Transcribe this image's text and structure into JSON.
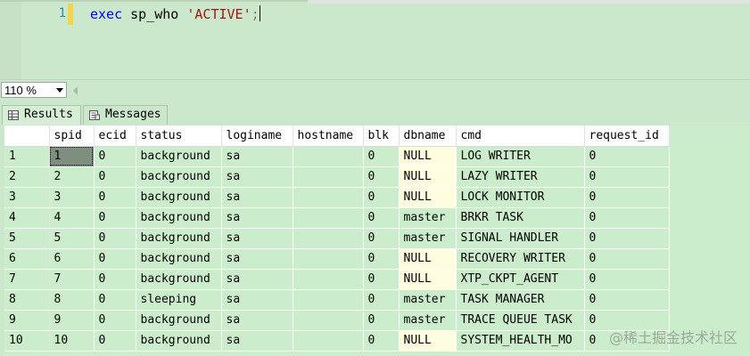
{
  "editor": {
    "line_number": "1",
    "code": {
      "keyword": "exec",
      "procedure": "sp_who",
      "argument": "'ACTIVE'",
      "terminator": ";"
    }
  },
  "zoom": {
    "value": "110 %"
  },
  "tabs": [
    {
      "label": "Results",
      "icon": "grid-icon",
      "active": true
    },
    {
      "label": "Messages",
      "icon": "message-icon",
      "active": false
    }
  ],
  "grid": {
    "columns": [
      "spid",
      "ecid",
      "status",
      "loginame",
      "hostname",
      "blk",
      "dbname",
      "cmd",
      "request_id"
    ],
    "rows": [
      [
        "1",
        "0",
        "background",
        "sa",
        "",
        "0",
        "NULL",
        "LOG WRITER",
        "0"
      ],
      [
        "2",
        "0",
        "background",
        "sa",
        "",
        "0",
        "NULL",
        "LAZY WRITER",
        "0"
      ],
      [
        "3",
        "0",
        "background",
        "sa",
        "",
        "0",
        "NULL",
        "LOCK MONITOR",
        "0"
      ],
      [
        "4",
        "0",
        "background",
        "sa",
        "",
        "0",
        "master",
        "BRKR TASK",
        "0"
      ],
      [
        "5",
        "0",
        "background",
        "sa",
        "",
        "0",
        "master",
        "SIGNAL HANDLER",
        "0"
      ],
      [
        "6",
        "0",
        "background",
        "sa",
        "",
        "0",
        "NULL",
        "RECOVERY WRITER",
        "0"
      ],
      [
        "7",
        "0",
        "background",
        "sa",
        "",
        "0",
        "NULL",
        "XTP_CKPT_AGENT",
        "0"
      ],
      [
        "8",
        "0",
        "sleeping",
        "sa",
        "",
        "0",
        "master",
        "TASK MANAGER",
        "0"
      ],
      [
        "9",
        "0",
        "background",
        "sa",
        "",
        "0",
        "master",
        "TRACE QUEUE TASK",
        "0"
      ],
      [
        "10",
        "0",
        "background",
        "sa",
        "",
        "0",
        "NULL",
        "SYSTEM_HEALTH_MO",
        "0"
      ]
    ]
  },
  "watermark": "@稀土掘金技术社区",
  "colors": {
    "background": "#cce8cc",
    "keyword": "#0000ff",
    "string": "#a31515",
    "line_number": "#2b91af",
    "null_cell": "#fffde0"
  }
}
